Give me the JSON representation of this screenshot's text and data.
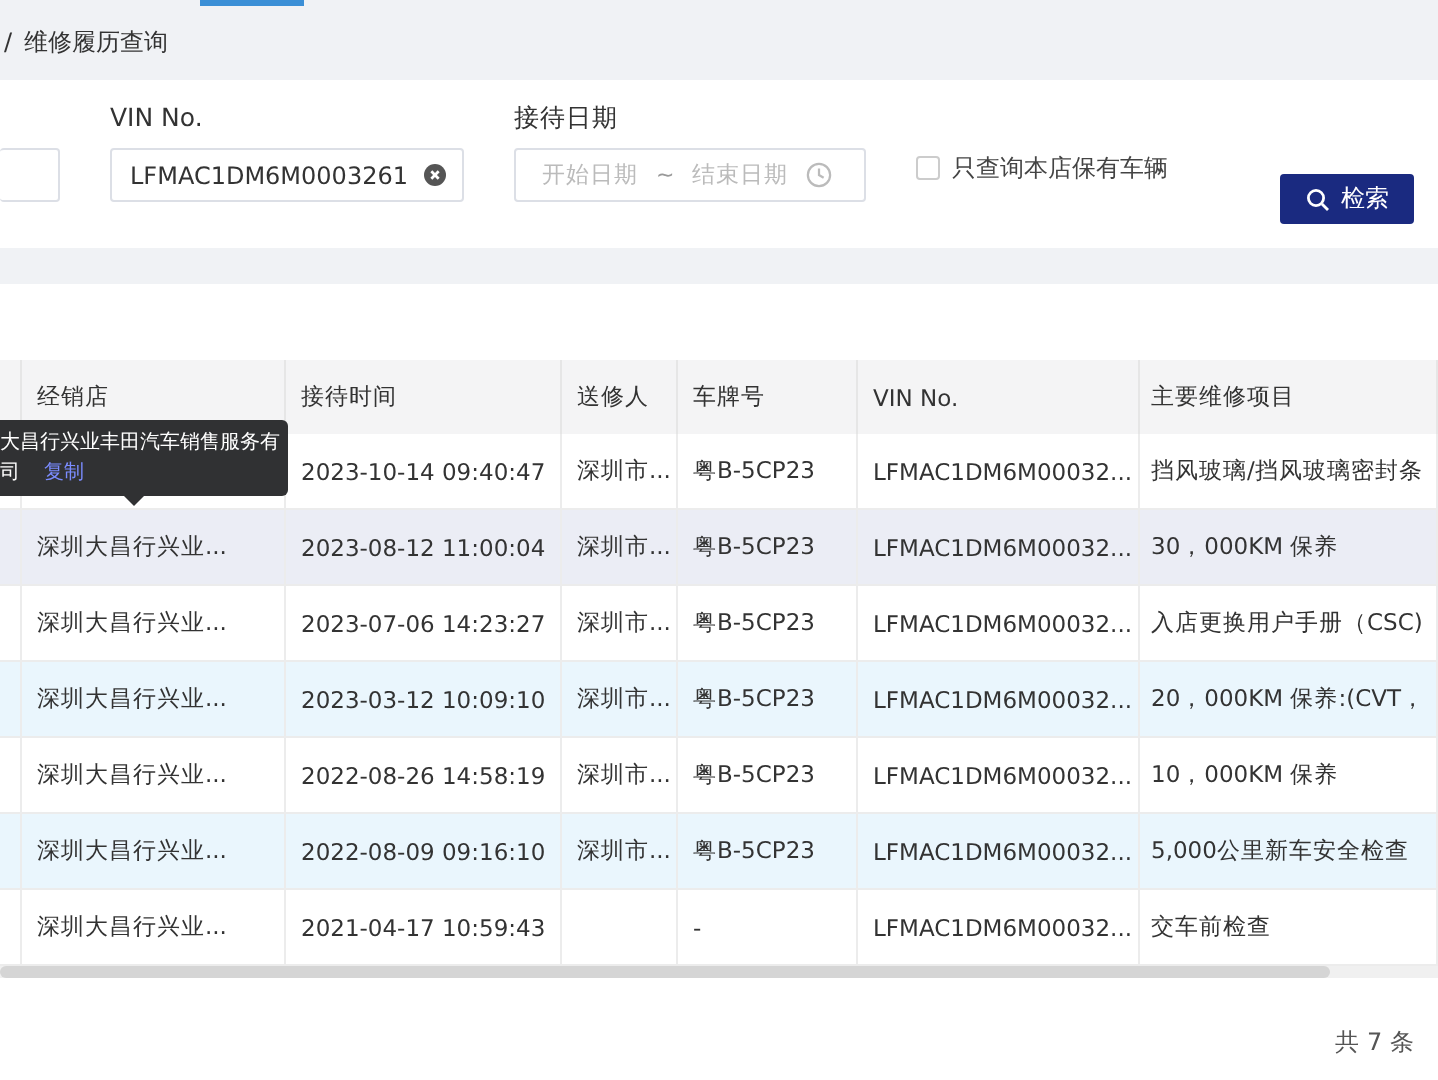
{
  "breadcrumb": {
    "separator": "/",
    "current": "维修履历查询"
  },
  "filters": {
    "vin": {
      "label": "VIN No.",
      "value": "LFMAC1DM6M0003261"
    },
    "date": {
      "label": "接待日期",
      "start_placeholder": "开始日期",
      "separator": "~",
      "end_placeholder": "结束日期"
    },
    "own_vehicles": {
      "label": "只查询本店保有车辆",
      "checked": false
    },
    "search_button": "检索"
  },
  "table": {
    "columns": [
      "经销店",
      "接待时间",
      "送修人",
      "车牌号",
      "VIN No.",
      "主要维修项目"
    ],
    "rows": [
      {
        "hovered": false,
        "striped": false,
        "cells": [
          null,
          "2023-10-14 09:40:47",
          "深圳市...",
          "粤B-5CP23",
          "LFMAC1DM6M00032...",
          "挡风玻璃/挡风玻璃密封条"
        ]
      },
      {
        "hovered": true,
        "striped": false,
        "cells": [
          "深圳大昌行兴业...",
          "2023-08-12 11:00:04",
          "深圳市...",
          "粤B-5CP23",
          "LFMAC1DM6M00032...",
          "30，000KM 保养"
        ]
      },
      {
        "hovered": false,
        "striped": false,
        "cells": [
          "深圳大昌行兴业...",
          "2023-07-06 14:23:27",
          "深圳市...",
          "粤B-5CP23",
          "LFMAC1DM6M00032...",
          "入店更换用户手册（CSC)"
        ]
      },
      {
        "hovered": false,
        "striped": true,
        "cells": [
          "深圳大昌行兴业...",
          "2023-03-12 10:09:10",
          "深圳市...",
          "粤B-5CP23",
          "LFMAC1DM6M00032...",
          "20，000KM 保养:(CVT，"
        ]
      },
      {
        "hovered": false,
        "striped": false,
        "cells": [
          "深圳大昌行兴业...",
          "2022-08-26 14:58:19",
          "深圳市...",
          "粤B-5CP23",
          "LFMAC1DM6M00032...",
          "10，000KM 保养"
        ]
      },
      {
        "hovered": false,
        "striped": true,
        "cells": [
          "深圳大昌行兴业...",
          "2022-08-09 09:16:10",
          "深圳市...",
          "粤B-5CP23",
          "LFMAC1DM6M00032...",
          "5,000公里新车安全检查"
        ]
      },
      {
        "hovered": false,
        "striped": false,
        "cells": [
          "深圳大昌行兴业...",
          "2021-04-17 10:59:43",
          null,
          "-",
          "LFMAC1DM6M00032...",
          "交车前检查"
        ]
      }
    ]
  },
  "tooltip": {
    "lines": [
      "大昌行兴业丰田汽车销售服务有",
      "司"
    ],
    "link": "复制"
  },
  "total": "共 7 条"
}
